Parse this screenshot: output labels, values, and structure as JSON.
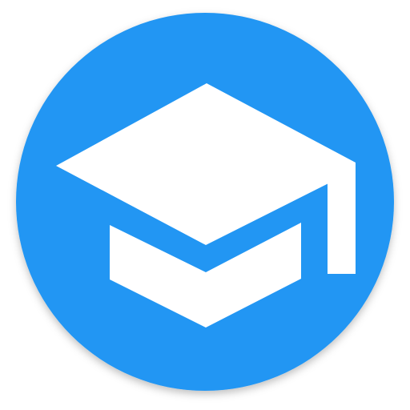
{
  "icon": {
    "name": "graduation-cap-app-icon",
    "background_color": "#2196F3",
    "foreground_color": "#FFFFFF",
    "symbol": "graduation-cap-icon"
  }
}
